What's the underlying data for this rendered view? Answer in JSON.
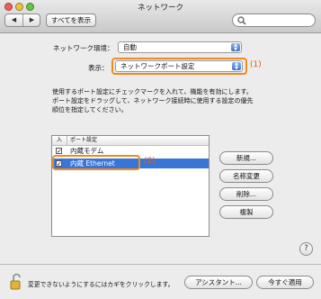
{
  "window": {
    "title": "ネットワーク",
    "show_all_label": "すべてを表示",
    "search_placeholder": ""
  },
  "location": {
    "label": "ネットワーク環境：",
    "value": "自動"
  },
  "show": {
    "label": "表示：",
    "value": "ネットワークポート設定"
  },
  "annotations": {
    "one": "(1)",
    "two": "(2)"
  },
  "description": {
    "line1": "使用するポート設定にチェックマークを入れて、機能を有効にします。",
    "line2": "ポート設定をドラッグして、ネットワーク接続時に使用する設定の優先",
    "line3": "順位を指定してください。"
  },
  "port_list": {
    "col_on": "入",
    "col_name": "ポート設定",
    "rows": [
      {
        "checked": true,
        "name": "内蔵モデム"
      },
      {
        "checked": true,
        "name": "内蔵 Ethernet"
      }
    ]
  },
  "buttons": {
    "new": "新規...",
    "rename": "名称変更",
    "delete": "削除...",
    "duplicate": "複製",
    "assistant": "アシスタント...",
    "apply_now": "今すぐ適用"
  },
  "lock_text": "変更できないようにするにはカギをクリックします。",
  "help_label": "?",
  "colors": {
    "highlight": "#3875d7",
    "annotation": "#f08a1c"
  }
}
